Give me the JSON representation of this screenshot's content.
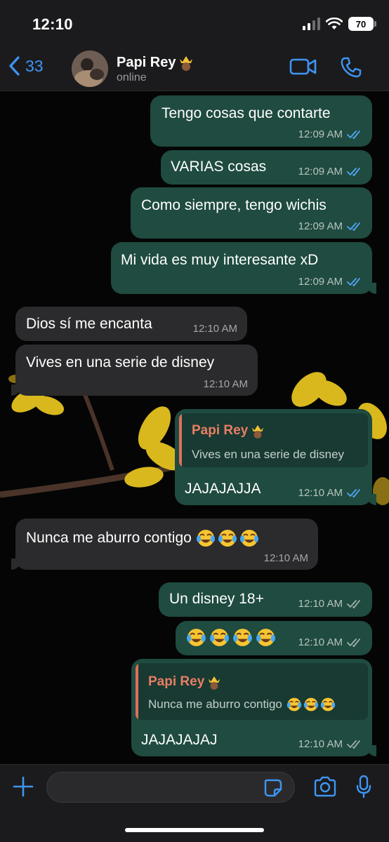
{
  "status_bar": {
    "time": "12:10",
    "battery": "70"
  },
  "header": {
    "back_count": "33",
    "contact_name": "Papi Rey",
    "contact_status": "online"
  },
  "messages": [
    {
      "direction": "out",
      "text": "Tengo cosas que contarte",
      "time": "12:09 AM",
      "ticks": "read"
    },
    {
      "direction": "out",
      "text": "VARIAS cosas",
      "time": "12:09 AM",
      "ticks": "read"
    },
    {
      "direction": "out",
      "text": "Como siempre, tengo wichis",
      "time": "12:09 AM",
      "ticks": "read"
    },
    {
      "direction": "out",
      "text": "Mi vida es muy interesante xD",
      "time": "12:09 AM",
      "ticks": "read"
    },
    {
      "direction": "in",
      "text": "Dios sí me encanta",
      "time": "12:10 AM"
    },
    {
      "direction": "in",
      "text": "Vives en una serie de disney",
      "time": "12:10 AM"
    },
    {
      "direction": "out",
      "quote_name": "Papi Rey",
      "quote_text": "Vives en una serie de disney",
      "text": "JAJAJAJJA",
      "time": "12:10 AM",
      "ticks": "read"
    },
    {
      "direction": "in",
      "text": "Nunca me aburro contigo",
      "emoji_count": 3,
      "time": "12:10 AM"
    },
    {
      "direction": "out",
      "text": "Un disney 18+",
      "time": "12:10 AM",
      "ticks": "delivered"
    },
    {
      "direction": "out",
      "text": "",
      "emoji_count": 4,
      "time": "12:10 AM",
      "ticks": "delivered"
    },
    {
      "direction": "out",
      "quote_name": "Papi Rey",
      "quote_text": "Nunca me aburro contigo",
      "quote_emoji_count": 3,
      "text": "JAJAJAJAJ",
      "time": "12:10 AM",
      "ticks": "delivered"
    }
  ],
  "icons": {
    "back": "chevron-left-icon",
    "video": "video-call-icon",
    "call": "phone-icon",
    "plus": "plus-icon",
    "sticker": "sticker-icon",
    "camera": "camera-icon",
    "mic": "microphone-icon",
    "crown": "crown-emoji",
    "laugh": "tears-of-joy-emoji"
  },
  "colors": {
    "accent": "#3e95f3",
    "outgoing_bubble": "#1f4b40",
    "incoming_bubble": "#2b2b2d",
    "read_tick": "#53a6f5",
    "quote_name": "#e87e64"
  }
}
